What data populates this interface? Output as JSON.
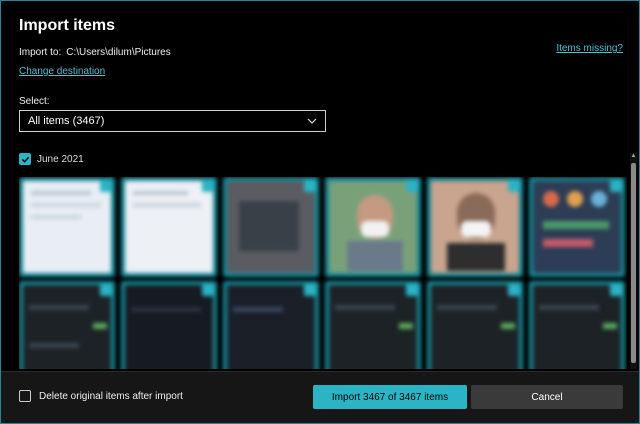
{
  "dialog": {
    "title": "Import items",
    "import_to_label": "Import to:",
    "import_path": "C:\\Users\\dilum\\Pictures",
    "change_destination": "Change destination",
    "items_missing": "Items missing?",
    "select_label": "Select:",
    "select_value": "All items (3467)",
    "group_label": "June 2021",
    "delete_label": "Delete original items after import",
    "import_button": "Import 3467 of 3467 items",
    "cancel_button": "Cancel"
  },
  "colors": {
    "accent": "#2bb3c6",
    "border": "#1f8a96",
    "link": "#4cc2d6",
    "background": "#000000",
    "footer": "#161616",
    "cancel": "#3a3a3a"
  },
  "thumbnails_row1": [
    {
      "kind": "document-screenshot",
      "bg": "#e8eef4",
      "checked": true
    },
    {
      "kind": "document-screenshot",
      "bg": "#edf0f5",
      "checked": true
    },
    {
      "kind": "dark-screenshot",
      "bg": "#5a5c62",
      "checked": true
    },
    {
      "kind": "photo-person-mask",
      "bg": "#7aa07a",
      "checked": true
    },
    {
      "kind": "photo-person-mask",
      "bg": "#c9a48e",
      "checked": true
    },
    {
      "kind": "colorful-screenshot",
      "bg": "#2c3d55",
      "checked": true
    }
  ],
  "thumbnails_row2": [
    {
      "kind": "dark-screenshot",
      "bg": "#1c2226",
      "checked": true
    },
    {
      "kind": "dark-screenshot",
      "bg": "#161a22",
      "checked": true
    },
    {
      "kind": "dark-screenshot",
      "bg": "#1a1f28",
      "checked": true
    },
    {
      "kind": "dark-screenshot",
      "bg": "#1c2226",
      "checked": true
    },
    {
      "kind": "dark-screenshot",
      "bg": "#1c2226",
      "checked": true
    },
    {
      "kind": "dark-screenshot",
      "bg": "#1c2226",
      "checked": true
    }
  ]
}
